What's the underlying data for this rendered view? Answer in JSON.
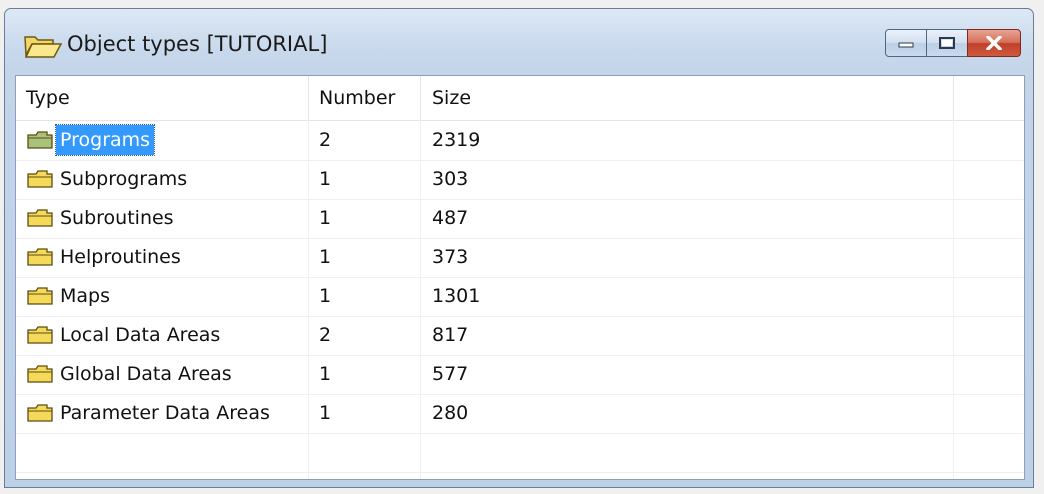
{
  "window": {
    "title": "Object types  [TUTORIAL]",
    "title_icon": "open-folder-icon",
    "buttons": {
      "minimize_icon": "minimize-icon",
      "maximize_icon": "maximize-icon",
      "close_icon": "close-icon"
    }
  },
  "table": {
    "columns": [
      "Type",
      "Number",
      "Size"
    ],
    "selected_index": 0,
    "row_icon": "folder-icon",
    "rows": [
      {
        "type": "Programs",
        "number": "2",
        "size": "2319"
      },
      {
        "type": "Subprograms",
        "number": "1",
        "size": "303"
      },
      {
        "type": "Subroutines",
        "number": "1",
        "size": "487"
      },
      {
        "type": "Helproutines",
        "number": "1",
        "size": "373"
      },
      {
        "type": "Maps",
        "number": "1",
        "size": "1301"
      },
      {
        "type": "Local Data Areas",
        "number": "2",
        "size": "817"
      },
      {
        "type": "Global Data Areas",
        "number": "1",
        "size": "577"
      },
      {
        "type": "Parameter Data Areas",
        "number": "1",
        "size": "280"
      }
    ]
  },
  "colors": {
    "selection": "#3399ff",
    "folder_fill": "#f5d95a",
    "selected_folder_fill": "#a9c27a"
  }
}
